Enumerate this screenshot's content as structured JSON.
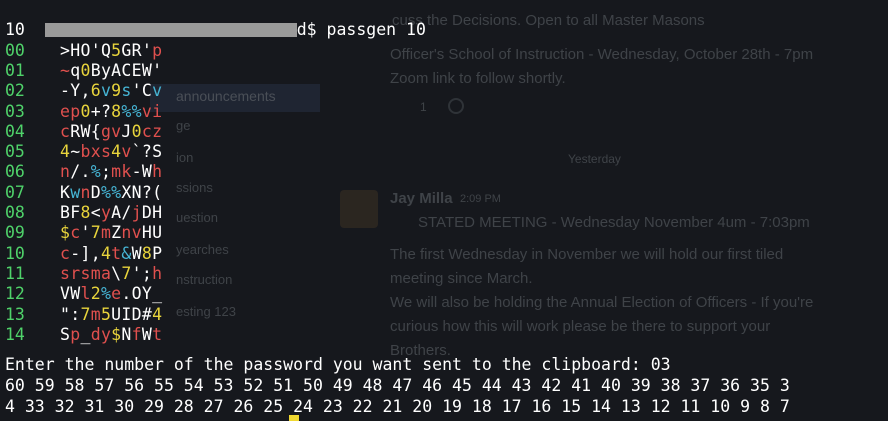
{
  "prompt": {
    "end": "d$ passgen 10"
  },
  "count_line": "10",
  "passwords": [
    {
      "num": "00",
      "chars": [
        ">",
        "H",
        "O",
        "'",
        "Q",
        "5",
        "G",
        "R",
        "'",
        "p"
      ],
      "colors": [
        "w",
        "w",
        "w",
        "w",
        "w",
        "y",
        "w",
        "w",
        "w",
        "r"
      ]
    },
    {
      "num": "01",
      "chars": [
        "~",
        "q",
        "0",
        "B",
        "y",
        "A",
        "C",
        "E",
        "W",
        "'"
      ],
      "colors": [
        "r",
        "w",
        "y",
        "w",
        "w",
        "w",
        "w",
        "w",
        "w",
        "w"
      ]
    },
    {
      "num": "02",
      "chars": [
        "-",
        "Y",
        ",",
        "6",
        "v",
        "9",
        "s",
        "'",
        "C",
        "v"
      ],
      "colors": [
        "w",
        "w",
        "w",
        "y",
        "c",
        "y",
        "c",
        "w",
        "w",
        "c"
      ]
    },
    {
      "num": "03",
      "chars": [
        "e",
        "p",
        "0",
        "+",
        "?",
        "8",
        "%",
        "%",
        "v",
        "i"
      ],
      "colors": [
        "r",
        "r",
        "y",
        "w",
        "w",
        "y",
        "c",
        "c",
        "r",
        "r"
      ]
    },
    {
      "num": "04",
      "chars": [
        "c",
        "R",
        "W",
        "{",
        "g",
        "v",
        "J",
        "0",
        "c",
        "z"
      ],
      "colors": [
        "r",
        "w",
        "w",
        "w",
        "r",
        "r",
        "w",
        "y",
        "r",
        "r"
      ]
    },
    {
      "num": "05",
      "chars": [
        "4",
        "~",
        "b",
        "x",
        "s",
        "4",
        "v",
        "`",
        "?",
        "S"
      ],
      "colors": [
        "y",
        "w",
        "r",
        "r",
        "r",
        "y",
        "r",
        "w",
        "w",
        "w"
      ]
    },
    {
      "num": "06",
      "chars": [
        "n",
        "/",
        ".",
        "%",
        ";",
        "m",
        "k",
        "-",
        "W",
        "h"
      ],
      "colors": [
        "r",
        "w",
        "w",
        "c",
        "w",
        "r",
        "r",
        "w",
        "w",
        "r"
      ]
    },
    {
      "num": "07",
      "chars": [
        "K",
        "w",
        "n",
        "D",
        "%",
        "%",
        "X",
        "N",
        "?",
        "("
      ],
      "colors": [
        "w",
        "c",
        "r",
        "w",
        "c",
        "c",
        "w",
        "w",
        "w",
        "w"
      ]
    },
    {
      "num": "08",
      "chars": [
        "B",
        "F",
        "8",
        "<",
        "y",
        "A",
        "/",
        "j",
        "D",
        "H"
      ],
      "colors": [
        "w",
        "w",
        "y",
        "w",
        "r",
        "w",
        "w",
        "r",
        "w",
        "w"
      ]
    },
    {
      "num": "09",
      "chars": [
        "$",
        "c",
        "'",
        "7",
        "m",
        "Z",
        "n",
        "v",
        "H",
        "U"
      ],
      "colors": [
        "y",
        "r",
        "w",
        "y",
        "r",
        "w",
        "r",
        "r",
        "w",
        "w"
      ]
    },
    {
      "num": "10",
      "chars": [
        "c",
        "-",
        "]",
        ",",
        "4",
        "t",
        "&",
        "W",
        "8",
        "P"
      ],
      "colors": [
        "r",
        "w",
        "w",
        "w",
        "y",
        "r",
        "c",
        "w",
        "y",
        "w"
      ]
    },
    {
      "num": "11",
      "chars": [
        "s",
        "r",
        "s",
        "m",
        "a",
        "\\",
        "7",
        "'",
        ";",
        "h"
      ],
      "colors": [
        "r",
        "r",
        "r",
        "r",
        "r",
        "w",
        "y",
        "w",
        "w",
        "r"
      ]
    },
    {
      "num": "12",
      "chars": [
        "V",
        "W",
        "l",
        "2",
        "%",
        "e",
        ".",
        "O",
        "Y",
        "_"
      ],
      "colors": [
        "w",
        "w",
        "r",
        "y",
        "c",
        "r",
        "w",
        "w",
        "w",
        "w"
      ]
    },
    {
      "num": "13",
      "chars": [
        "\"",
        ":",
        "7",
        "m",
        "5",
        "U",
        "I",
        "D",
        "#",
        "4"
      ],
      "colors": [
        "w",
        "w",
        "y",
        "r",
        "y",
        "w",
        "w",
        "w",
        "w",
        "y"
      ]
    },
    {
      "num": "14",
      "chars": [
        "S",
        "p",
        "_",
        "d",
        "y",
        "$",
        "N",
        "f",
        "W",
        "t"
      ],
      "colors": [
        "w",
        "r",
        "w",
        "r",
        "r",
        "y",
        "w",
        "r",
        "w",
        "r"
      ]
    }
  ],
  "clipboard_prompt": "Enter the number of the password you want sent to the clipboard: 03",
  "countdown_line1": "60 59 58 57 56 55 54 53 52 51 50 49 48 47 46 45 44 43 42 41 40 39 38 37 36 35 3",
  "countdown_line2": "4 33 32 31 30 29 28 27 26 25 24 23 22 21 20 19 18 17 16 15 14 13 12 11 10 9 8 7",
  "background": {
    "post1_text": "cuss the Decisions. Open to all Master Masons",
    "post2_title": "Officer's School of Instruction - Wednesday, October 28th - 7pm",
    "post2_sub": "Zoom link to follow shortly.",
    "sidebar_active": "announcements",
    "sidebar_items": [
      "ge",
      "ion",
      "ssions",
      "uestion",
      "yearches",
      "nstruction",
      "esting 123"
    ],
    "date_divider": "Yesterday",
    "author": "Jay Milla",
    "time": "2:09 PM",
    "meeting_title": "STATED MEETING - Wednesday November 4um - 7:03pm",
    "body_lines": [
      "The first Wednesday in November we will hold our first tiled",
      "meeting since March.",
      "We will also be holding the Annual Election of Officers - If you're",
      "curious how this will work please be there to support your",
      "Brothers."
    ],
    "reactions": [
      "1",
      "1"
    ]
  },
  "colors": {
    "bg": "#16181d",
    "number": "#4fd26a",
    "red": "#e0504e",
    "cyan": "#46b4d4",
    "yellow": "#e8d43c",
    "cursor": "#f0d830"
  }
}
